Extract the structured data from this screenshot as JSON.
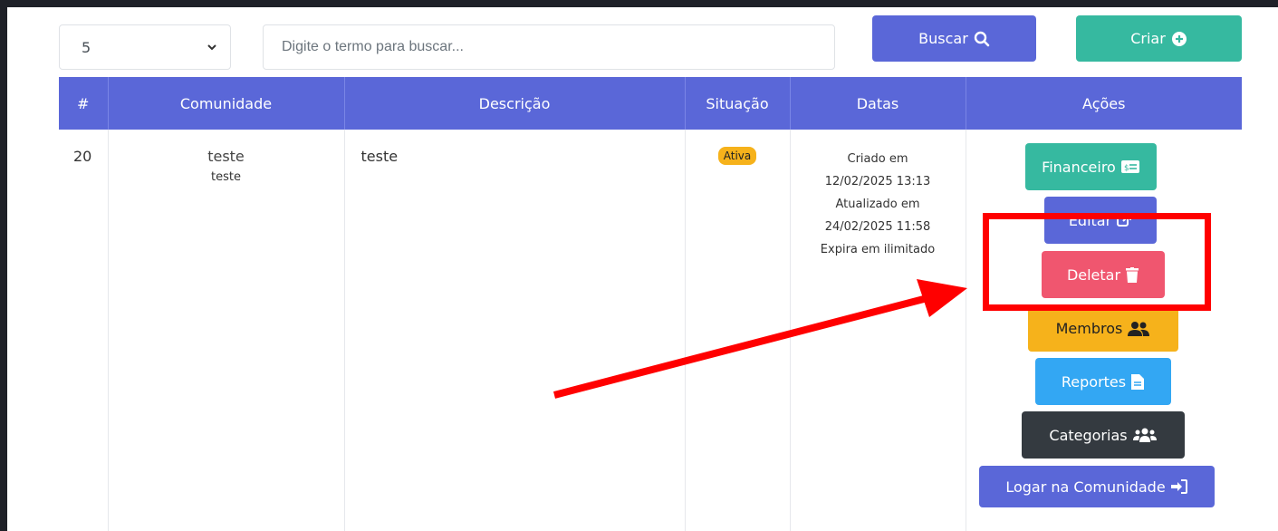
{
  "toolbar": {
    "page_size_value": "5",
    "search_placeholder": "Digite o termo para buscar...",
    "search_button_label": "Buscar",
    "create_button_label": "Criar"
  },
  "table": {
    "headers": [
      "#",
      "Comunidade",
      "Descrição",
      "Situação",
      "Datas",
      "Ações"
    ],
    "rows": [
      {
        "id": "20",
        "community_name": "teste",
        "community_sub": "teste",
        "description": "teste",
        "status": "Ativa",
        "dates": {
          "created_label": "Criado em",
          "created_value": "12/02/2025 13:13",
          "updated_label": "Atualizado em",
          "updated_value": "24/02/2025 11:58",
          "expires": "Expira em ilimitado"
        },
        "actions": {
          "financeiro": "Financeiro",
          "editar": "Editar",
          "deletar": "Deletar",
          "membros": "Membros",
          "reportes": "Reportes",
          "categorias": "Categorias",
          "logar": "Logar na Comunidade"
        }
      }
    ]
  },
  "colors": {
    "primary": "#5a67d8",
    "success": "#36b9a0",
    "danger": "#f0566f",
    "warning": "#f6b21b",
    "info": "#33a7f3",
    "dark": "#343a40",
    "annotation": "#ff0000"
  },
  "icons": {
    "search": "search-icon",
    "create": "plus-circle-icon",
    "financeiro": "money-bill-icon",
    "editar": "external-link-icon",
    "deletar": "trash-icon",
    "membros": "user-group-icon",
    "reportes": "file-icon",
    "categorias": "users-icon",
    "logar": "sign-in-icon"
  }
}
